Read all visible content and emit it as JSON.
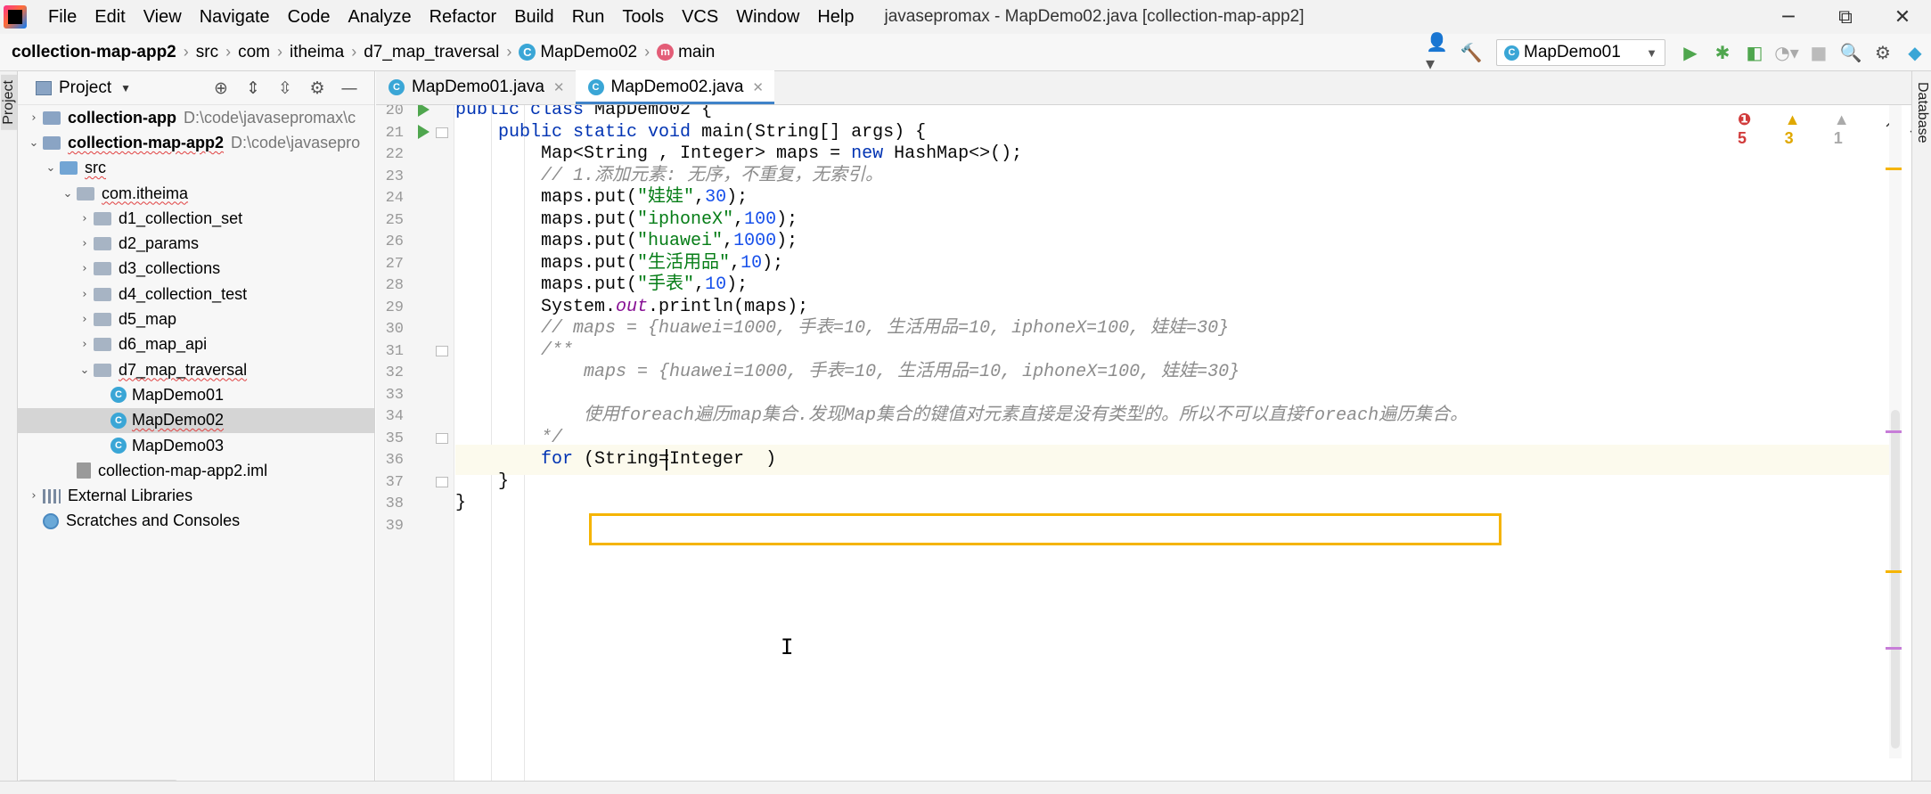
{
  "menubar": {
    "items": [
      "File",
      "Edit",
      "View",
      "Navigate",
      "Code",
      "Analyze",
      "Refactor",
      "Build",
      "Run",
      "Tools",
      "VCS",
      "Window",
      "Help"
    ],
    "window_title": "javasepromax - MapDemo02.java [collection-map-app2]",
    "controls": {
      "minimize": "─",
      "restore": "⧉",
      "close": "✕"
    }
  },
  "navbar": {
    "breadcrumbs": [
      "collection-map-app2",
      "src",
      "com",
      "itheima",
      "d7_map_traversal",
      "MapDemo02",
      "main"
    ],
    "run_config": "MapDemo01",
    "icons": [
      "user-icon",
      "hammer-icon",
      "run-icon",
      "debug-icon",
      "coverage-icon",
      "profile-icon",
      "stop-icon",
      "search-icon",
      "settings-icon",
      "plugin-icon"
    ]
  },
  "tool_stripe": {
    "left_label": "Project",
    "right_label": "Database"
  },
  "project": {
    "title": "Project",
    "tree": [
      {
        "label": "collection-app",
        "path": "D:\\code\\javasepromax\\c",
        "level": 0,
        "arrow": "›",
        "kind": "module",
        "bold": true
      },
      {
        "label": "collection-map-app2",
        "path": "D:\\code\\javasepro",
        "level": 0,
        "arrow": "⌄",
        "kind": "module",
        "bold": true,
        "squiggle": true
      },
      {
        "label": "src",
        "level": 1,
        "arrow": "⌄",
        "kind": "src",
        "squiggle": true
      },
      {
        "label": "com.itheima",
        "level": 2,
        "arrow": "⌄",
        "kind": "pkg",
        "squiggle": true
      },
      {
        "label": "d1_collection_set",
        "level": 3,
        "arrow": "›",
        "kind": "pkg"
      },
      {
        "label": "d2_params",
        "level": 3,
        "arrow": "›",
        "kind": "pkg"
      },
      {
        "label": "d3_collections",
        "level": 3,
        "arrow": "›",
        "kind": "pkg"
      },
      {
        "label": "d4_collection_test",
        "level": 3,
        "arrow": "›",
        "kind": "pkg"
      },
      {
        "label": "d5_map",
        "level": 3,
        "arrow": "›",
        "kind": "pkg"
      },
      {
        "label": "d6_map_api",
        "level": 3,
        "arrow": "›",
        "kind": "pkg"
      },
      {
        "label": "d7_map_traversal",
        "level": 3,
        "arrow": "⌄",
        "kind": "pkg",
        "squiggle": true
      },
      {
        "label": "MapDemo01",
        "level": 4,
        "arrow": "",
        "kind": "class"
      },
      {
        "label": "MapDemo02",
        "level": 4,
        "arrow": "",
        "kind": "class",
        "selected": true,
        "squiggle": true
      },
      {
        "label": "MapDemo03",
        "level": 4,
        "arrow": "",
        "kind": "class"
      },
      {
        "label": "collection-map-app2.iml",
        "level": 2,
        "arrow": "",
        "kind": "iml"
      },
      {
        "label": "External Libraries",
        "level": 0,
        "arrow": "›",
        "kind": "lib"
      },
      {
        "label": "Scratches and Consoles",
        "level": 0,
        "arrow": "",
        "kind": "scratch"
      }
    ]
  },
  "tabs": [
    {
      "label": "MapDemo01.java",
      "active": false
    },
    {
      "label": "MapDemo02.java",
      "active": true
    }
  ],
  "inspections": {
    "errors": "5",
    "warnings": "3",
    "weak": "1"
  },
  "editor": {
    "lines": [
      {
        "n": "20",
        "run": true,
        "tokens": [
          [
            "kw",
            "public class "
          ],
          [
            "",
            "MapDemo02 {"
          ]
        ]
      },
      {
        "n": "21",
        "run": true,
        "fold": true,
        "tokens": [
          [
            "",
            "    "
          ],
          [
            "kw",
            "public static void "
          ],
          [
            "",
            "main(String[] args) {"
          ]
        ]
      },
      {
        "n": "22",
        "tokens": [
          [
            "",
            "        Map<String , Integer> maps = "
          ],
          [
            "kw",
            "new "
          ],
          [
            "",
            "HashMap<>();"
          ]
        ]
      },
      {
        "n": "23",
        "tokens": [
          [
            "",
            "        "
          ],
          [
            "cmt",
            "// 1.添加元素: 无序，不重复，无索引。"
          ]
        ]
      },
      {
        "n": "24",
        "tokens": [
          [
            "",
            "        maps.put("
          ],
          [
            "str",
            "\"娃娃\""
          ],
          [
            "",
            ","
          ],
          [
            "num",
            "30"
          ],
          [
            "",
            ");"
          ]
        ]
      },
      {
        "n": "25",
        "tokens": [
          [
            "",
            "        maps.put("
          ],
          [
            "str",
            "\"iphoneX\""
          ],
          [
            "",
            ","
          ],
          [
            "num",
            "100"
          ],
          [
            "",
            ");"
          ]
        ]
      },
      {
        "n": "26",
        "tokens": [
          [
            "",
            "        maps.put("
          ],
          [
            "str",
            "\"huawei\""
          ],
          [
            "",
            ","
          ],
          [
            "num",
            "1000"
          ],
          [
            "",
            ");"
          ]
        ]
      },
      {
        "n": "27",
        "tokens": [
          [
            "",
            "        maps.put("
          ],
          [
            "str",
            "\"生活用品\""
          ],
          [
            "",
            ","
          ],
          [
            "num",
            "10"
          ],
          [
            "",
            ");"
          ]
        ]
      },
      {
        "n": "28",
        "tokens": [
          [
            "",
            "        maps.put("
          ],
          [
            "str",
            "\"手表\""
          ],
          [
            "",
            ","
          ],
          [
            "num",
            "10"
          ],
          [
            "",
            ");"
          ]
        ]
      },
      {
        "n": "29",
        "tokens": [
          [
            "",
            "        System."
          ],
          [
            "field",
            "out"
          ],
          [
            "",
            ".println(maps);"
          ]
        ]
      },
      {
        "n": "30",
        "tokens": [
          [
            "",
            "        "
          ],
          [
            "cmt",
            "// maps = {huawei=1000, 手表=10, 生活用品=10, iphoneX=100, 娃娃=30}"
          ]
        ]
      },
      {
        "n": "31",
        "fold": true,
        "tokens": [
          [
            "",
            "        "
          ],
          [
            "cmt",
            "/**"
          ]
        ]
      },
      {
        "n": "32",
        "tokens": [
          [
            "",
            "            "
          ],
          [
            "cmt",
            "maps = {huawei=1000, 手表=10, 生活用品=10, iphoneX=100, 娃娃=30}"
          ]
        ]
      },
      {
        "n": "33",
        "tokens": []
      },
      {
        "n": "34",
        "tokens": [
          [
            "",
            "            "
          ],
          [
            "cmt",
            "使用foreach遍历map集合.发现Map集合的键值对元素直接是没有类型的。所以不可以直接foreach遍历集合。"
          ]
        ]
      },
      {
        "n": "35",
        "fold": true,
        "tokens": [
          [
            "",
            "       "
          ],
          [
            "cmt",
            " */"
          ]
        ]
      },
      {
        "n": "36",
        "current": true,
        "tokens": [
          [
            "",
            "       "
          ],
          [
            "kw",
            " for "
          ],
          [
            "",
            "(String=Integer  )"
          ]
        ]
      },
      {
        "n": "37",
        "fold": true,
        "tokens": [
          [
            "",
            "    }"
          ]
        ]
      },
      {
        "n": "38",
        "tokens": [
          [
            "",
            "}"
          ]
        ]
      },
      {
        "n": "39",
        "tokens": []
      }
    ]
  },
  "colors": {
    "accent": "#4083c9",
    "run_green": "#4fa64e",
    "highlight_box": "#f5b400",
    "keyword": "#0033b3",
    "string": "#067d17",
    "number": "#1750eb",
    "comment": "#8c8c8c"
  }
}
